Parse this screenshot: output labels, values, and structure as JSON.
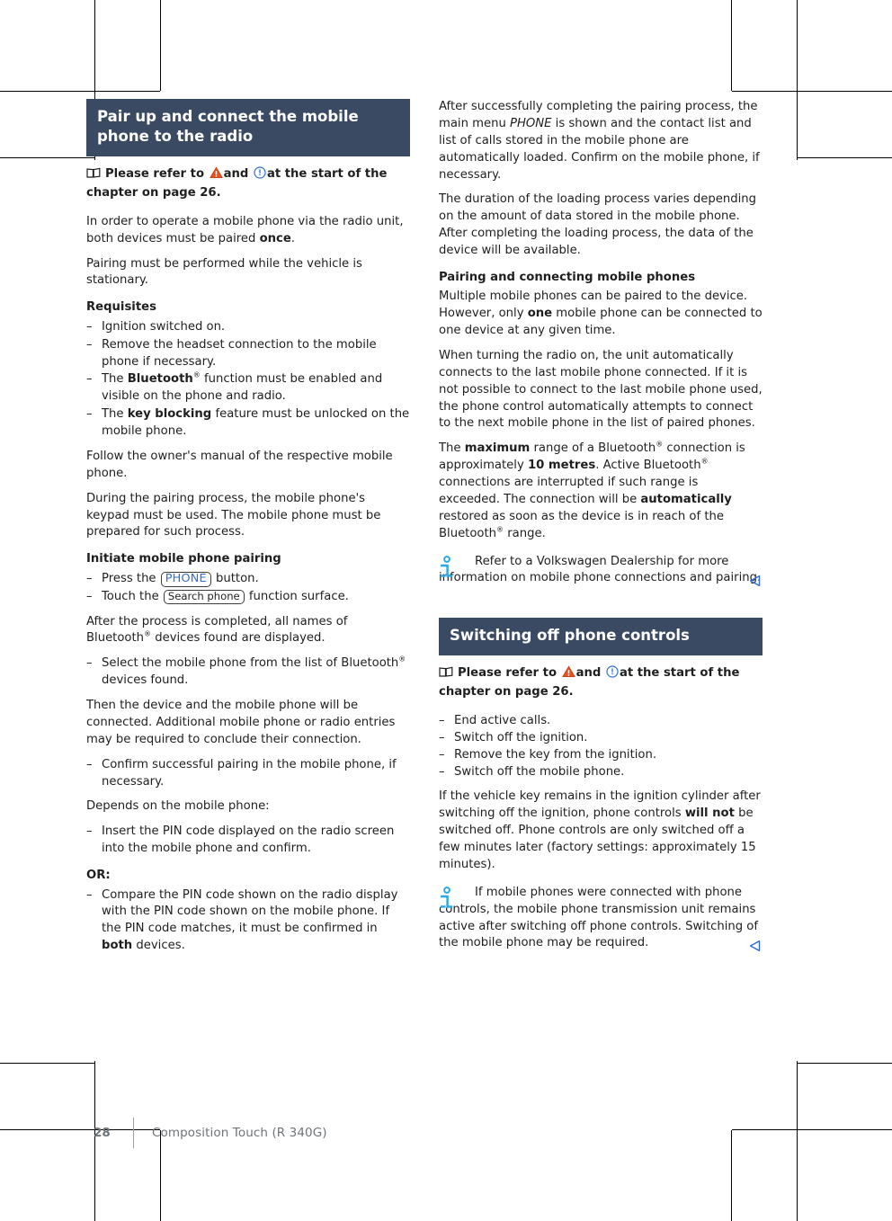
{
  "colors": {
    "section_bar_bg": "#3a4a63",
    "key_blue": "#2f6fd0",
    "info_blue": "#2aa8e0",
    "warning_orange": "#e8521e",
    "footer_gray": "#6e7479"
  },
  "left_column": {
    "section_title": "Pair up and connect the mobile phone to the radio",
    "refnote": {
      "prefix": "Please refer to",
      "middle": "and",
      "suffix": "at the start of the chapter on page 26.",
      "book_icon": "book-icon",
      "warning_icon": "warning-triangle-icon",
      "notice_icon": "notice-circle-icon"
    },
    "intro_1_a": "In order to operate a mobile phone via the radio unit, both devices must be paired ",
    "intro_1_bold": "once",
    "intro_1_b": ".",
    "intro_2": "Pairing must be performed while the vehicle is stationary.",
    "requisites_heading": "Requisites",
    "requisites": [
      {
        "text_a": "Ignition switched on.",
        "bold": "",
        "text_b": ""
      },
      {
        "text_a": "Remove the headset connection to the mobile phone if necessary.",
        "bold": "",
        "text_b": ""
      },
      {
        "text_a": "The ",
        "bold": "Bluetooth",
        "reg": true,
        "text_b": " function must be enabled and visible on the phone and radio."
      },
      {
        "text_a": "The ",
        "bold": "key blocking",
        "text_b": " feature must be unlocked on the mobile phone."
      }
    ],
    "follow_manual": "Follow the owner's manual of the respective mobile phone.",
    "during_pairing": "During the pairing process, the mobile phone's keypad must be used. The mobile phone must be prepared for such process.",
    "initiate_heading": "Initiate mobile phone pairing",
    "initiate_steps": [
      {
        "pre": "Press the ",
        "chip": "PHONE",
        "chip_style": "key",
        "post": " button."
      },
      {
        "pre": "Touch the ",
        "chip": "Search phone",
        "chip_style": "surface",
        "post": " function surface."
      }
    ],
    "after_process_a": "After the process is completed, all names of Bluetooth",
    "after_process_b": " devices found are displayed.",
    "select_phone_a": "Select the mobile phone from the list of Bluetooth",
    "select_phone_b": " devices found.",
    "then_device": "Then the device and the mobile phone will be connected. Additional mobile phone or radio entries may be required to conclude their connection.",
    "confirm_pairing": "Confirm successful pairing in the mobile phone, if necessary.",
    "depends_on": "Depends on the mobile phone:",
    "insert_pin": "Insert the PIN code displayed on the radio screen into the mobile phone and confirm.",
    "or_label": "OR:",
    "compare_pin_a": "Compare the PIN code shown on the radio display with the PIN code shown on the mobile phone. If the PIN code matches, it must be confirmed in ",
    "compare_pin_bold": "both",
    "compare_pin_b": " devices."
  },
  "right_column": {
    "after_success_a": "After successfully completing the pairing process, the main menu ",
    "after_success_italic": "PHONE",
    "after_success_b": " is shown and the contact list and list of calls stored in the mobile phone are automatically loaded. Confirm on the mobile phone, if necessary.",
    "duration": "The duration of the loading process varies depending on the amount of data stored in the mobile phone. After completing the loading process, the data of the device will be available.",
    "pairing_heading": "Pairing and connecting mobile phones",
    "multiple_a": "Multiple mobile phones can be paired to the device. However, only ",
    "multiple_bold": "one",
    "multiple_b": " mobile phone can be connected to one device at any given time.",
    "when_turning": "When turning the radio on, the unit automatically connects to the last mobile phone connected. If it is not possible to connect to the last mobile phone used, the phone control automatically attempts to connect to the next mobile phone in the list of paired phones.",
    "max_range_1": "The ",
    "max_range_bold1": "maximum",
    "max_range_2": " range of a Bluetooth",
    "max_range_3": " connection is approximately ",
    "max_range_bold2": "10 metres",
    "max_range_4": ". Active Bluetooth",
    "max_range_5": " connections are interrupted if such range is exceeded. The connection will be ",
    "max_range_bold3": "automatically",
    "max_range_6": " restored as soon as the device is in reach of the Bluetooth",
    "max_range_7": " range.",
    "note_1": "Refer to a Volkswagen Dealership for more information on mobile phone connections and pairing.",
    "section_title_2": "Switching off phone controls",
    "refnote_2": {
      "prefix": "Please refer to",
      "middle": "and",
      "suffix": "at the start of the chapter on page 26.",
      "book_icon": "book-icon",
      "warning_icon": "warning-triangle-icon",
      "notice_icon": "notice-circle-icon"
    },
    "switch_off_steps": [
      "End active calls.",
      "Switch off the ignition.",
      "Remove the key from the ignition.",
      "Switch off the mobile phone."
    ],
    "vehicle_key_a": "If the vehicle key remains in the ignition cylinder after switching off the ignition, phone controls ",
    "vehicle_key_bold": "will not",
    "vehicle_key_b": " be switched off. Phone controls are only switched off a few minutes later (factory settings: approximately 15 minutes).",
    "note_2": "If mobile phones were connected with phone controls, the mobile phone transmission unit remains active after switching off phone controls. Switching of the mobile phone may be required."
  },
  "footer": {
    "page_number": "28",
    "document_title": "Composition Touch (R 340G)"
  }
}
